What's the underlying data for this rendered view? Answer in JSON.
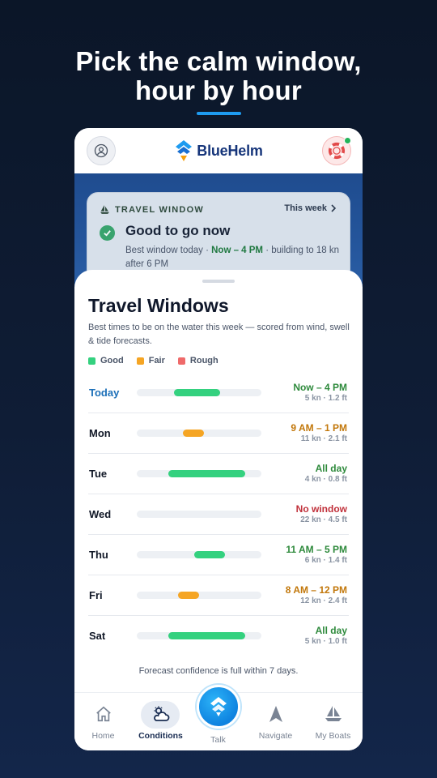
{
  "headline": {
    "line1": "Pick the calm window,",
    "line2": "hour by hour"
  },
  "appbar": {
    "brand_name": "BlueHelm",
    "icons": {
      "profile": "user-icon",
      "help": "lifebuoy-icon"
    }
  },
  "travel_card": {
    "label": "TRAVEL WINDOW",
    "link": "This week",
    "title": "Good to go now",
    "sub_prefix": "Best window today · ",
    "sub_highlight": "Now – 4 PM",
    "sub_suffix": " · building to 18 kn after 6 PM"
  },
  "sheet": {
    "title": "Travel Windows",
    "subtitle": "Best times to be on the water this week — scored from wind, swell & tide forecasts.",
    "legend": [
      {
        "label": "Good",
        "color": "#34d17f"
      },
      {
        "label": "Fair",
        "color": "#f5a524"
      },
      {
        "label": "Rough",
        "color": "#ef6a6a"
      }
    ],
    "rows": [
      {
        "day": "Today",
        "window": "Now – 4 PM",
        "meta": "5 kn · 1.2 ft",
        "status": "good",
        "start": 0.3,
        "end": 0.67,
        "is_today": true
      },
      {
        "day": "Mon",
        "window": "9 AM – 1 PM",
        "meta": "11 kn · 2.1 ft",
        "status": "fair",
        "start": 0.37,
        "end": 0.54
      },
      {
        "day": "Tue",
        "window": "All day",
        "meta": "4 kn · 0.8 ft",
        "status": "good",
        "start": 0.25,
        "end": 0.87
      },
      {
        "day": "Wed",
        "window": "No window",
        "meta": "22 kn · 4.5 ft",
        "status": "none",
        "start": 0,
        "end": 0
      },
      {
        "day": "Thu",
        "window": "11 AM – 5 PM",
        "meta": "6 kn · 1.4 ft",
        "status": "good",
        "start": 0.46,
        "end": 0.71
      },
      {
        "day": "Fri",
        "window": "8 AM – 12 PM",
        "meta": "12 kn · 2.4 ft",
        "status": "fair",
        "start": 0.33,
        "end": 0.5
      },
      {
        "day": "Sat",
        "window": "All day",
        "meta": "5 kn · 1.0 ft",
        "status": "good",
        "start": 0.25,
        "end": 0.87
      }
    ],
    "confidence": "Forecast confidence is full within 7 days."
  },
  "colors": {
    "good_bar": "#34d17f",
    "fair_bar": "#f5a524",
    "good_text": "#2e8a3c",
    "fair_text": "#c2770a",
    "none_text": "#c0303a"
  },
  "nav": {
    "items": [
      {
        "label": "Home",
        "icon": "home-icon"
      },
      {
        "label": "Conditions",
        "icon": "weather-icon",
        "active": true
      },
      {
        "label": "Talk",
        "icon": "helm-logo-icon"
      },
      {
        "label": "Navigate",
        "icon": "navigate-arrow-icon"
      },
      {
        "label": "My Boats",
        "icon": "sailboat-icon"
      }
    ]
  }
}
